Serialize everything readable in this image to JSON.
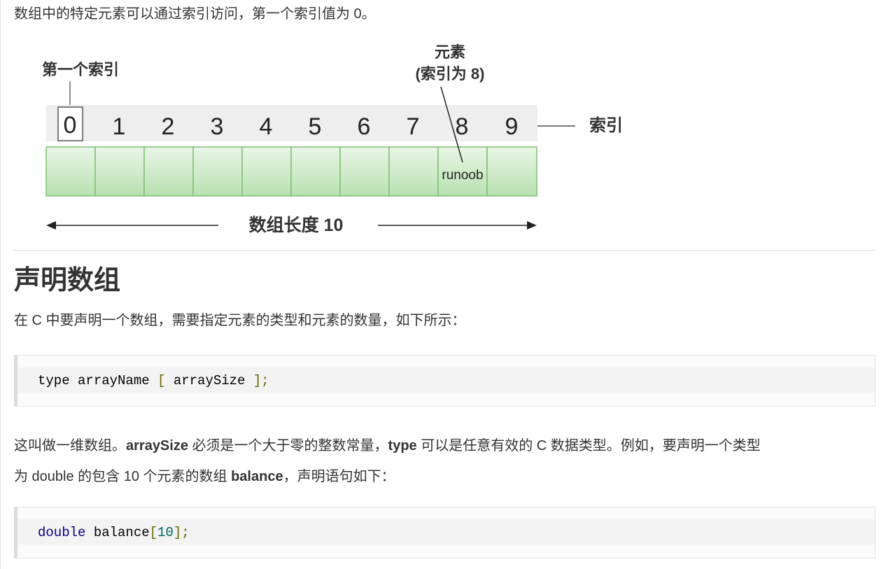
{
  "intro": "数组中的特定元素可以通过索引访问，第一个索引值为 0。",
  "diagram": {
    "first_index_label": "第一个索引",
    "element_label_line1": "元素",
    "element_label_line2": "(索引为 8)",
    "index_label": "索引",
    "indices": [
      "0",
      "1",
      "2",
      "3",
      "4",
      "5",
      "6",
      "7",
      "8",
      "9"
    ],
    "element_value": "runoob",
    "length_label": "数组长度 10",
    "colors": {
      "index_bar": "#eeeeee",
      "cell_fill_top": "#eaf6e8",
      "cell_fill_bottom": "#b8e0b0",
      "cell_border": "#7fbf72"
    }
  },
  "section": {
    "title": "声明数组",
    "intro": "在 C 中要声明一个数组，需要指定元素的类型和元素的数量，如下所示：",
    "code1": {
      "t1": "type arrayName ",
      "t2": "[",
      "t3": " arraySize ",
      "t4": "];"
    },
    "para2": {
      "p1": "这叫做一维数组。",
      "b1": "arraySize",
      "p2": " 必须是一个大于零的整数常量，",
      "b2": "type",
      "p3": " 可以是任意有效的 C 数据类型。例如，要声明一个类型",
      "p4": "为 double 的包含 10 个元素的数组 ",
      "b3": "balance",
      "p5": "，声明语句如下："
    },
    "code2": {
      "kw": "double",
      "t1": " balance",
      "t2": "[",
      "num": "10",
      "t3": "];"
    }
  }
}
